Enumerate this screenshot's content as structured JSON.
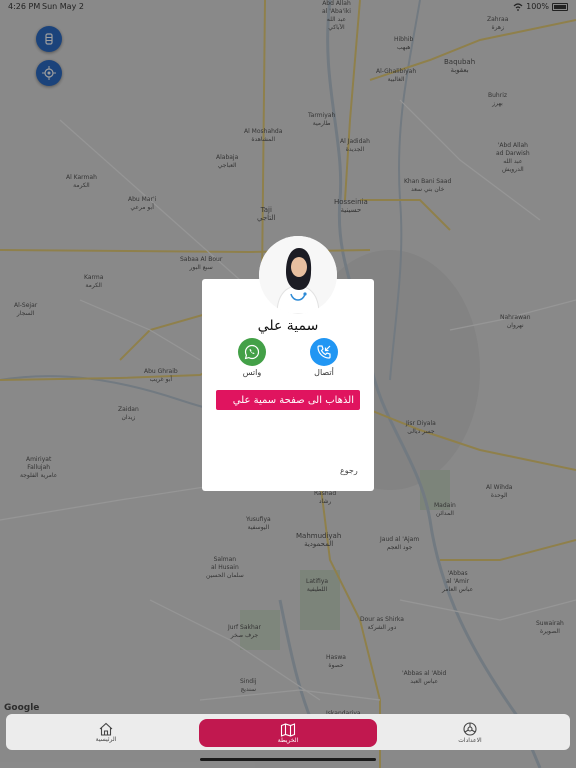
{
  "status_bar": {
    "time": "4:26 PM",
    "date": "Sun May 2",
    "battery": "100%"
  },
  "map": {
    "google_label": "Google",
    "places": [
      {
        "name": "Abd Allah\nal 'Aba'iki\nعبد الله\nالآباكي"
      },
      {
        "name": "Al-Ghalibiyah\nالغالبية"
      },
      {
        "name": "Baqubah\nبعقوبة"
      },
      {
        "name": "Zahraa\nزهرة"
      },
      {
        "name": "Hibhib\nهبهب"
      },
      {
        "name": "Buhriz\nبهرز"
      },
      {
        "name": "Tarmiyah\nطارمية"
      },
      {
        "name": "Al Moshahda\nالمشاهدة"
      },
      {
        "name": "Al Jadidah\nالجديدة"
      },
      {
        "name": "Alabaja\nالعباجي"
      },
      {
        "name": "Al Karmah\nالكرمة"
      },
      {
        "name": "Abu Mar'i\nأبو مرعي"
      },
      {
        "name": "Hosseinia\nحسينية"
      },
      {
        "name": "Khan Bani Saad\nخان بني سعد"
      },
      {
        "name": "'Abd Allah\nad Darwish\nعبد الله\nالدرويش"
      },
      {
        "name": "Taji\nالتاجي"
      },
      {
        "name": "Sabaa Al Bour\nسبع البور"
      },
      {
        "name": "Karma\nالكرمة"
      },
      {
        "name": "Al-Sejar\nالسجار"
      },
      {
        "name": "Nahrawan\nنهروان"
      },
      {
        "name": "Abu Ghraib\nأبو غريب"
      },
      {
        "name": "Zaidan\nزيدان"
      },
      {
        "name": "Amiriyat\nFallujah\nعامرية الفلوجة"
      },
      {
        "name": "Jisr Diyala\nجسر ديالى"
      },
      {
        "name": "Al Wihda\nالوحدة"
      },
      {
        "name": "Madain\nالمدائن"
      },
      {
        "name": "Yusufiya\nاليوسفية"
      },
      {
        "name": "Mahmudiyah\nالمحمودية"
      },
      {
        "name": "Jaud al 'Ajam\nجود العجم"
      },
      {
        "name": "Salman\nal Husain\nسلمان الحسين"
      },
      {
        "name": "Latifiya\nاللطيفية"
      },
      {
        "name": "Dour as Shirka\nدور الشركة"
      },
      {
        "name": "'Abbas\nal 'Amir\nعباس العامر"
      },
      {
        "name": "Suwairah\nالصويرة"
      },
      {
        "name": "Jurf Sakhar\nجرف صخر"
      },
      {
        "name": "Haswa\nحصوة"
      },
      {
        "name": "Sindij\nسنديج"
      },
      {
        "name": "'Abbas al 'Abid\nعباس العبد"
      },
      {
        "name": "Iskandariya\nالإسكندرية"
      },
      {
        "name": "Rashad\nرشاد"
      }
    ]
  },
  "modal": {
    "name": "سمية علي",
    "call_label": "أتصال",
    "whatsapp_label": "واتس",
    "goto_label": "الذهاب الى صفحة سمية علي",
    "back_label": "رجوع"
  },
  "tabs": [
    {
      "label": "الرئيسية",
      "icon": "home-icon"
    },
    {
      "label": "الخريطة",
      "icon": "map-icon",
      "active": true
    },
    {
      "label": "الاعدادات",
      "icon": "settings-icon"
    }
  ],
  "colors": {
    "accent": "#c1184f",
    "button": "#e0145f",
    "whatsapp": "#43a047",
    "call": "#2196f3",
    "fab": "#2d6cc7"
  }
}
